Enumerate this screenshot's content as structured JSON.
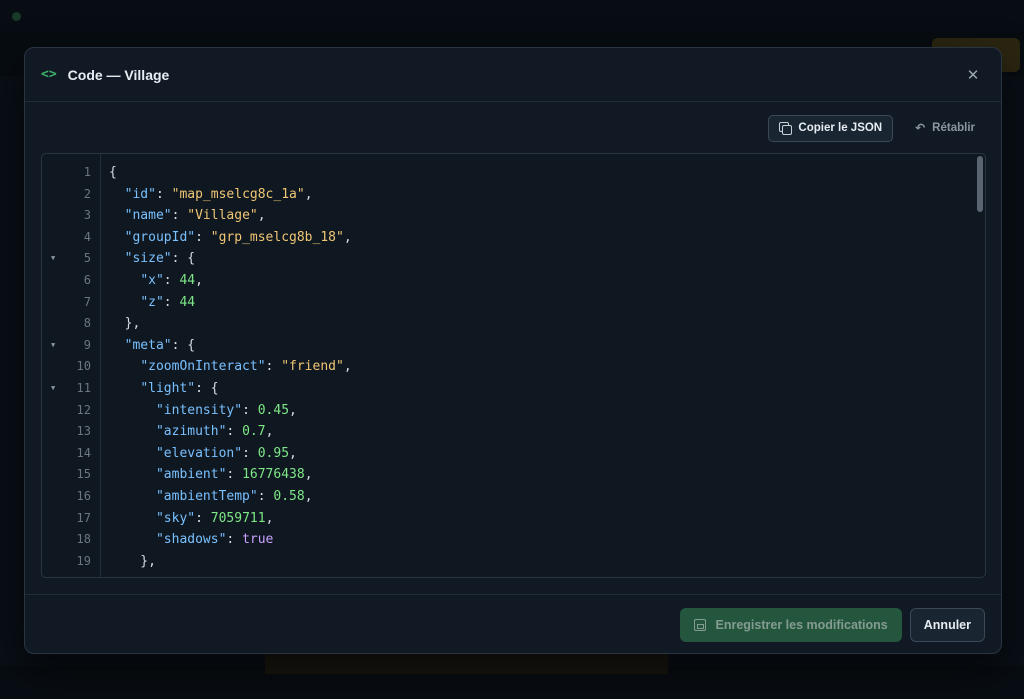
{
  "modal": {
    "title": "Code — Village",
    "copy_label": "Copier le JSON",
    "reset_label": "Rétablir",
    "save_label": "Enregistrer les modifications",
    "cancel_label": "Annuler"
  },
  "icons": {
    "header": "code-icon",
    "close": "close-icon",
    "copy": "copy-icon",
    "reset": "undo-icon",
    "save": "save-icon",
    "fold": "fold-arrow-icon"
  },
  "colors": {
    "accent": "#3fb26a",
    "save_button": "#2b6a47",
    "json_key": "#79c0ff",
    "json_string": "#f0c674",
    "json_number": "#7ee787",
    "json_boolean": "#c9a0ff"
  },
  "editor": {
    "folded_lines": [
      5,
      9,
      11
    ],
    "lines": [
      [
        [
          "pun",
          "{"
        ]
      ],
      [
        [
          "pun",
          "  "
        ],
        [
          "key",
          "\"id\""
        ],
        [
          "pun",
          ": "
        ],
        [
          "str",
          "\"map_mselcg8c_1a\""
        ],
        [
          "pun",
          ","
        ]
      ],
      [
        [
          "pun",
          "  "
        ],
        [
          "key",
          "\"name\""
        ],
        [
          "pun",
          ": "
        ],
        [
          "str",
          "\"Village\""
        ],
        [
          "pun",
          ","
        ]
      ],
      [
        [
          "pun",
          "  "
        ],
        [
          "key",
          "\"groupId\""
        ],
        [
          "pun",
          ": "
        ],
        [
          "str",
          "\"grp_mselcg8b_18\""
        ],
        [
          "pun",
          ","
        ]
      ],
      [
        [
          "pun",
          "  "
        ],
        [
          "key",
          "\"size\""
        ],
        [
          "pun",
          ": {"
        ]
      ],
      [
        [
          "pun",
          "    "
        ],
        [
          "key",
          "\"x\""
        ],
        [
          "pun",
          ": "
        ],
        [
          "num",
          "44"
        ],
        [
          "pun",
          ","
        ]
      ],
      [
        [
          "pun",
          "    "
        ],
        [
          "key",
          "\"z\""
        ],
        [
          "pun",
          ": "
        ],
        [
          "num",
          "44"
        ]
      ],
      [
        [
          "pun",
          "  },"
        ]
      ],
      [
        [
          "pun",
          "  "
        ],
        [
          "key",
          "\"meta\""
        ],
        [
          "pun",
          ": {"
        ]
      ],
      [
        [
          "pun",
          "    "
        ],
        [
          "key",
          "\"zoomOnInteract\""
        ],
        [
          "pun",
          ": "
        ],
        [
          "str",
          "\"friend\""
        ],
        [
          "pun",
          ","
        ]
      ],
      [
        [
          "pun",
          "    "
        ],
        [
          "key",
          "\"light\""
        ],
        [
          "pun",
          ": {"
        ]
      ],
      [
        [
          "pun",
          "      "
        ],
        [
          "key",
          "\"intensity\""
        ],
        [
          "pun",
          ": "
        ],
        [
          "num",
          "0.45"
        ],
        [
          "pun",
          ","
        ]
      ],
      [
        [
          "pun",
          "      "
        ],
        [
          "key",
          "\"azimuth\""
        ],
        [
          "pun",
          ": "
        ],
        [
          "num",
          "0.7"
        ],
        [
          "pun",
          ","
        ]
      ],
      [
        [
          "pun",
          "      "
        ],
        [
          "key",
          "\"elevation\""
        ],
        [
          "pun",
          ": "
        ],
        [
          "num",
          "0.95"
        ],
        [
          "pun",
          ","
        ]
      ],
      [
        [
          "pun",
          "      "
        ],
        [
          "key",
          "\"ambient\""
        ],
        [
          "pun",
          ": "
        ],
        [
          "num",
          "16776438"
        ],
        [
          "pun",
          ","
        ]
      ],
      [
        [
          "pun",
          "      "
        ],
        [
          "key",
          "\"ambientTemp\""
        ],
        [
          "pun",
          ": "
        ],
        [
          "num",
          "0.58"
        ],
        [
          "pun",
          ","
        ]
      ],
      [
        [
          "pun",
          "      "
        ],
        [
          "key",
          "\"sky\""
        ],
        [
          "pun",
          ": "
        ],
        [
          "num",
          "7059711"
        ],
        [
          "pun",
          ","
        ]
      ],
      [
        [
          "pun",
          "      "
        ],
        [
          "key",
          "\"shadows\""
        ],
        [
          "pun",
          ": "
        ],
        [
          "bool",
          "true"
        ]
      ],
      [
        [
          "pun",
          "    },"
        ]
      ]
    ]
  }
}
